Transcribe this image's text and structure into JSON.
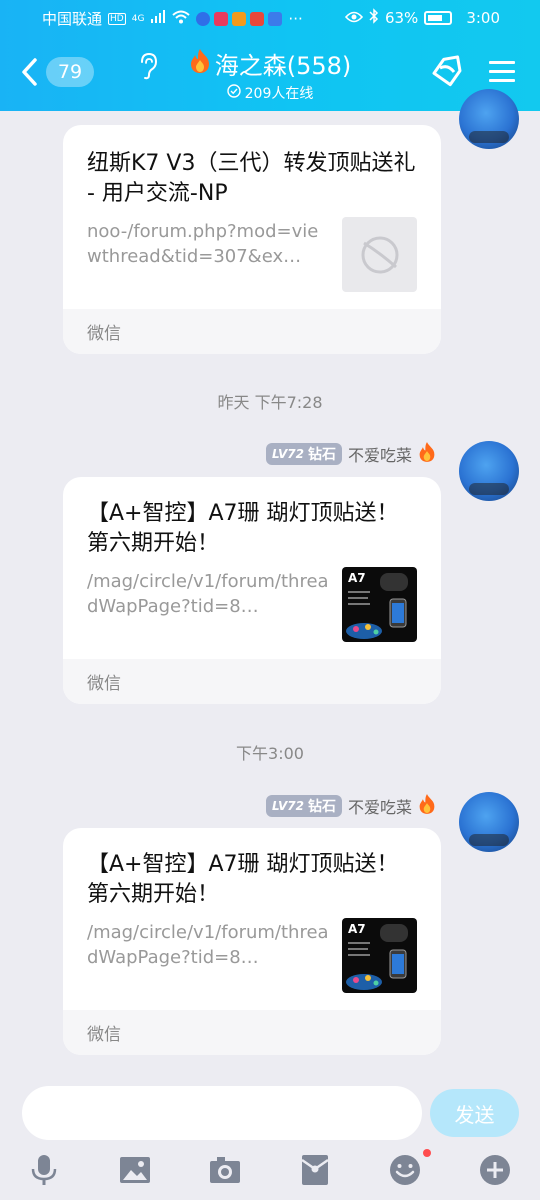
{
  "colors": {
    "header_start": "#19b3f5",
    "header_end": "#12c9ef",
    "send_button": "#b5e7fb",
    "level_badge": "#a9b0c3",
    "notification_dot": "#ff4d4f"
  },
  "status_bar": {
    "carrier": "中国联通",
    "hd_badge": "HD",
    "network": "4G",
    "more": "···",
    "battery": "63%",
    "time": "3:00"
  },
  "header": {
    "unread_count": "79",
    "group_name": "海之森(558)",
    "online": "209人在线",
    "icons": [
      "chevron-left-icon",
      "ear-icon",
      "fire-icon",
      "tag-icon",
      "menu-icon"
    ]
  },
  "messages": [
    {
      "card_title": "纽斯K7 V3（三代）转发顶贴送礼 - 用户交流-NP",
      "card_url": "noo-/forum.php?mod=viewthread&tid=307&ex…",
      "source": "微信",
      "thumb": "placeholder"
    },
    {
      "time": "昨天 下午7:28",
      "level": "LV72",
      "rank": "钻石",
      "sender": "不爱吃菜",
      "card_title": "【A+智控】A7珊 瑚灯顶贴送！ 第六期开始！",
      "card_url": "/mag/circle/v1/forum/threadWapPage?tid=8…",
      "source": "微信",
      "thumb_title": "A7"
    },
    {
      "time": "下午3:00",
      "level": "LV72",
      "rank": "钻石",
      "sender": "不爱吃菜",
      "card_title": "【A+智控】A7珊 瑚灯顶贴送！ 第六期开始！",
      "card_url": "/mag/circle/v1/forum/threadWapPage?tid=8…",
      "source": "微信",
      "thumb_title": "A7"
    }
  ],
  "composer": {
    "input_value": "",
    "send_label": "发送"
  },
  "toolbar_icons": [
    "microphone-icon",
    "image-icon",
    "camera-icon",
    "red-packet-icon",
    "emoji-icon",
    "plus-icon"
  ]
}
